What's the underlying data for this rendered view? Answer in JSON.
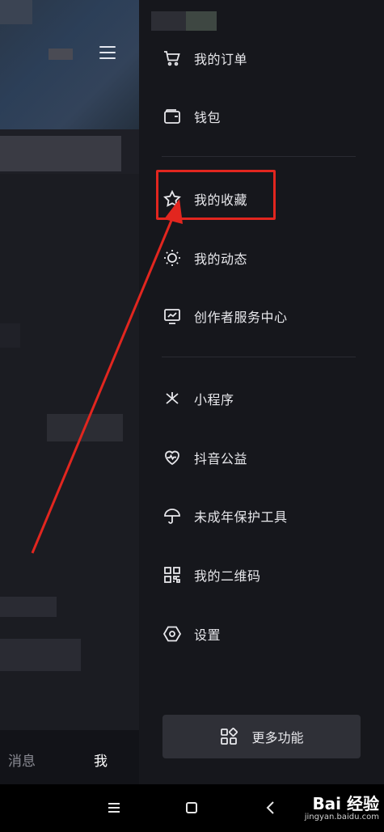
{
  "left": {
    "tabs": [
      {
        "label": "消息"
      },
      {
        "label": "我"
      }
    ]
  },
  "drawer": {
    "items": [
      {
        "label": "我的订单",
        "icon": "cart-icon"
      },
      {
        "label": "钱包",
        "icon": "wallet-icon"
      },
      {
        "label": "我的收藏",
        "icon": "star-icon"
      },
      {
        "label": "我的动态",
        "icon": "sun-icon"
      },
      {
        "label": "创作者服务中心",
        "icon": "chart-monitor-icon"
      },
      {
        "label": "小程序",
        "icon": "asterisk-icon"
      },
      {
        "label": "抖音公益",
        "icon": "heart-pulse-icon"
      },
      {
        "label": "未成年保护工具",
        "icon": "umbrella-icon"
      },
      {
        "label": "我的二维码",
        "icon": "qr-code-icon"
      },
      {
        "label": "设置",
        "icon": "hexagon-gear-icon"
      }
    ],
    "more_button": {
      "label": "更多功能",
      "icon": "grid-icon"
    }
  },
  "annotation": {
    "highlight_color": "#e2261f",
    "highlighted_item": "我的收藏"
  },
  "watermark": {
    "main": "Bai 经验",
    "sub": "jingyan.baidu.com"
  }
}
